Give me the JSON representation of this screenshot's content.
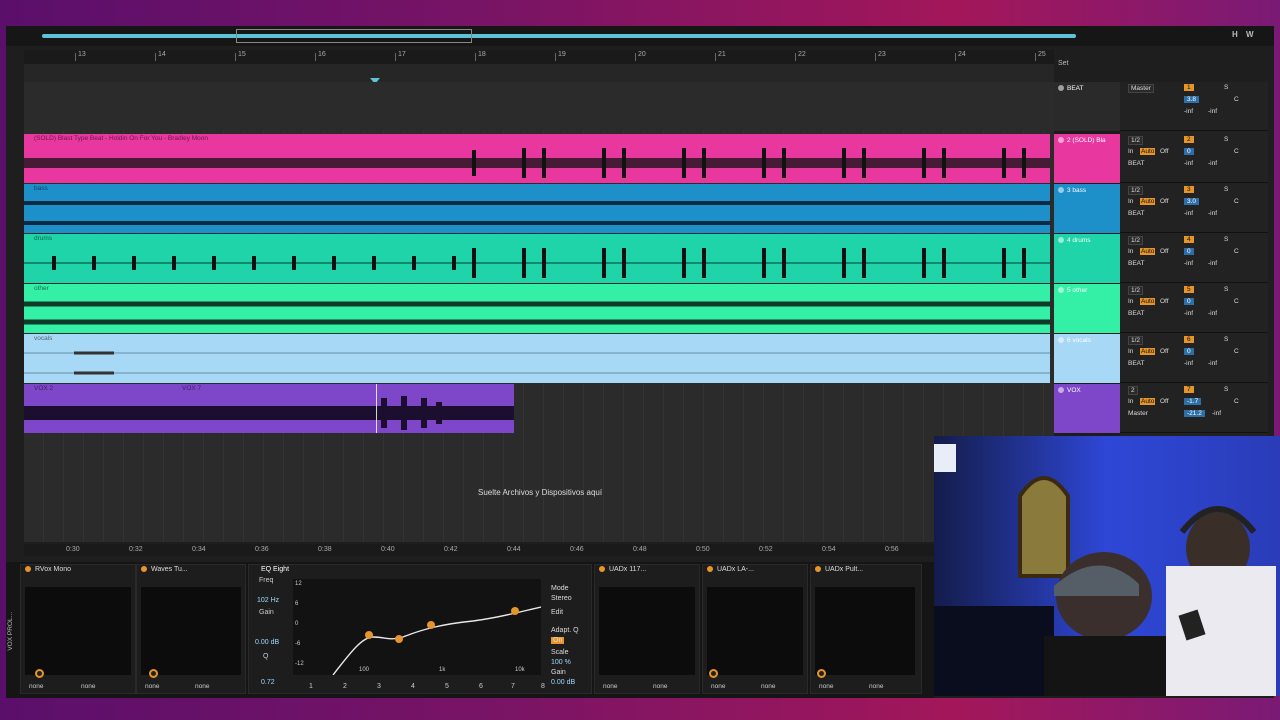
{
  "overview": {
    "toggles": [
      "H",
      "W"
    ]
  },
  "ruler": {
    "bars": [
      "13",
      "14",
      "15",
      "16",
      "17",
      "18",
      "19",
      "20",
      "21",
      "22",
      "23",
      "24",
      "25"
    ]
  },
  "set_label": "Set",
  "tracks": [
    {
      "name": "BEAT",
      "clip": "",
      "color": "#2b2b2b",
      "head_color": "#2a2a2a",
      "routing": "Master",
      "num": "1",
      "vol": "3.8",
      "pan": "C",
      "meter": "-inf",
      "meter2": "-inf"
    },
    {
      "name": "2 (SOLD) Bla",
      "clip": "(SOLD) Blast Type Beat - Holdin On For You - Bradley Moon",
      "color": "#e8379f",
      "head_color": "#e8379f",
      "routing": "1/2",
      "group": "BEAT",
      "num": "2",
      "vol": "0",
      "pan": "C",
      "meter": "-inf",
      "meter2": "-inf"
    },
    {
      "name": "3 bass",
      "clip": "bass",
      "color": "#1d8fc9",
      "head_color": "#1d8fc9",
      "routing": "1/2",
      "group": "BEAT",
      "num": "3",
      "vol": "3.0",
      "pan": "C",
      "meter": "-inf",
      "meter2": "-inf"
    },
    {
      "name": "4 drums",
      "clip": "drums",
      "color": "#1ed4a8",
      "head_color": "#1ed4a8",
      "routing": "1/2",
      "group": "BEAT",
      "num": "4",
      "vol": "0",
      "pan": "C",
      "meter": "-inf",
      "meter2": "-inf"
    },
    {
      "name": "5 other",
      "clip": "other",
      "color": "#33f0a6",
      "head_color": "#33f0a6",
      "routing": "1/2",
      "group": "BEAT",
      "num": "5",
      "vol": "0",
      "pan": "C",
      "meter": "-inf",
      "meter2": "-inf"
    },
    {
      "name": "6 vocals",
      "clip": "vocals",
      "color": "#a7d8f5",
      "head_color": "#a7d8f5",
      "routing": "1/2",
      "group": "BEAT",
      "num": "6",
      "vol": "0",
      "pan": "C",
      "meter": "-inf",
      "meter2": "-inf"
    },
    {
      "name": "VOX",
      "clip": "VOX 2",
      "clip2": "VOX 7",
      "color": "#7e47c9",
      "head_color": "#7e47c9",
      "routing": "2",
      "group": "Master",
      "num": "7",
      "vol": "-1.7",
      "pan": "C",
      "meter": "-21.2",
      "meter2": "-inf"
    }
  ],
  "mixer_labels": {
    "in": "In",
    "auto": "Auto",
    "off": "Off",
    "solo": "S"
  },
  "drop_text": "Suelte Archivos y Dispositivos aquí",
  "bottom_times": [
    "0:30",
    "0:32",
    "0:34",
    "0:36",
    "0:38",
    "0:40",
    "0:42",
    "0:44",
    "0:46",
    "0:48",
    "0:50",
    "0:52",
    "0:54",
    "0:56"
  ],
  "devices": {
    "chain_label": "VOX PROL...",
    "rvox": {
      "title": "RVox Mono",
      "sel1": "none",
      "sel2": "none"
    },
    "waves": {
      "title": "Waves Tu...",
      "sel1": "none",
      "sel2": "none"
    },
    "eq": {
      "title": "EQ Eight",
      "freq_label": "Freq",
      "freq": "102 Hz",
      "gain_label": "Gain",
      "gain": "0.00 dB",
      "q_label": "Q",
      "q": "0.72",
      "db_ticks": [
        "12",
        "6",
        "0",
        "-6",
        "-12"
      ],
      "hz_ticks": [
        "100",
        "1k",
        "10k"
      ],
      "mode_label": "Mode",
      "mode": "Stereo",
      "edit_label": "Edit",
      "adapt_label": "Adapt. Q",
      "adapt": "On",
      "scale_label": "Scale",
      "scale": "100 %",
      "gain2_label": "Gain",
      "gain2": "0.00 dB",
      "bands": [
        "1",
        "2",
        "3",
        "4",
        "5",
        "6",
        "7",
        "8"
      ]
    },
    "uadx1": {
      "title": "UADx 117...",
      "sel1": "none",
      "sel2": "none"
    },
    "uadx2": {
      "title": "UADx LA-...",
      "sel1": "none",
      "sel2": "none"
    },
    "uadx3": {
      "title": "UADx Pult...",
      "sel1": "none",
      "sel2": "none"
    }
  }
}
